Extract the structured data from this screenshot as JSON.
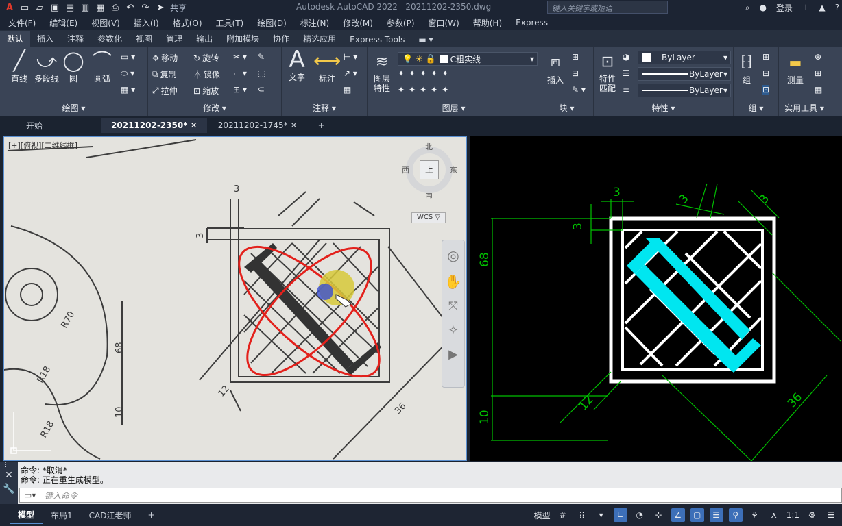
{
  "app": {
    "title": "Autodesk AutoCAD 2022",
    "file": "20211202-2350.dwg",
    "share": "共享",
    "search_placeholder": "键入关键字或短语",
    "login": "登录"
  },
  "menu": [
    "文件(F)",
    "编辑(E)",
    "视图(V)",
    "插入(I)",
    "格式(O)",
    "工具(T)",
    "绘图(D)",
    "标注(N)",
    "修改(M)",
    "参数(P)",
    "窗口(W)",
    "帮助(H)",
    "Express"
  ],
  "ribbon_tabs": [
    "默认",
    "插入",
    "注释",
    "参数化",
    "视图",
    "管理",
    "输出",
    "附加模块",
    "协作",
    "精选应用",
    "Express Tools"
  ],
  "panels": {
    "draw": {
      "title": "绘图 ▾",
      "tools": [
        "直线",
        "多段线",
        "圆",
        "圆弧"
      ]
    },
    "modify": {
      "title": "修改 ▾",
      "tools": [
        "移动",
        "旋转",
        "复制",
        "镜像",
        "拉伸",
        "缩放"
      ]
    },
    "annotation": {
      "title": "注释 ▾",
      "tools": [
        "文字",
        "标注"
      ]
    },
    "layers": {
      "title": "图层 ▾",
      "tool": "图层\n特性",
      "current_layer": "C粗实线"
    },
    "block": {
      "title": "块 ▾",
      "tool": "插入"
    },
    "properties": {
      "title": "特性 ▾",
      "tool": "特性\n匹配",
      "color": "ByLayer",
      "linetype": "ByLayer",
      "lineweight": "ByLayer"
    },
    "group": {
      "title": "组 ▾",
      "tool": "组"
    },
    "utilities": {
      "title": "实用工具 ▾",
      "tool": "测量"
    }
  },
  "doc_tabs": [
    "开始",
    "20211202-2350*",
    "20211202-1745*"
  ],
  "viewport_label": "[+][俯视][二维线框]",
  "viewcube": {
    "north": "北",
    "south": "南",
    "east": "东",
    "west": "西",
    "top": "上",
    "wcs": "WCS"
  },
  "drawing_dims": [
    "3",
    "3",
    "3",
    "3",
    "68",
    "10",
    "12",
    "36"
  ],
  "paper_labels": [
    "R70",
    "R18",
    "R18",
    "68",
    "10",
    "12",
    "36",
    "3",
    "3"
  ],
  "command": {
    "lines": [
      "命令: *取消*",
      "命令: 正在重生成模型。"
    ],
    "placeholder": "键入命令"
  },
  "status": {
    "tabs": [
      "模型",
      "布局1",
      "CAD江老师"
    ],
    "model_label": "模型",
    "scale": "1:1"
  },
  "colors": {
    "dim": "#00c000",
    "highlight": "#00e6f0",
    "frame": "#ffffff",
    "accent": "#5a8fd0"
  }
}
